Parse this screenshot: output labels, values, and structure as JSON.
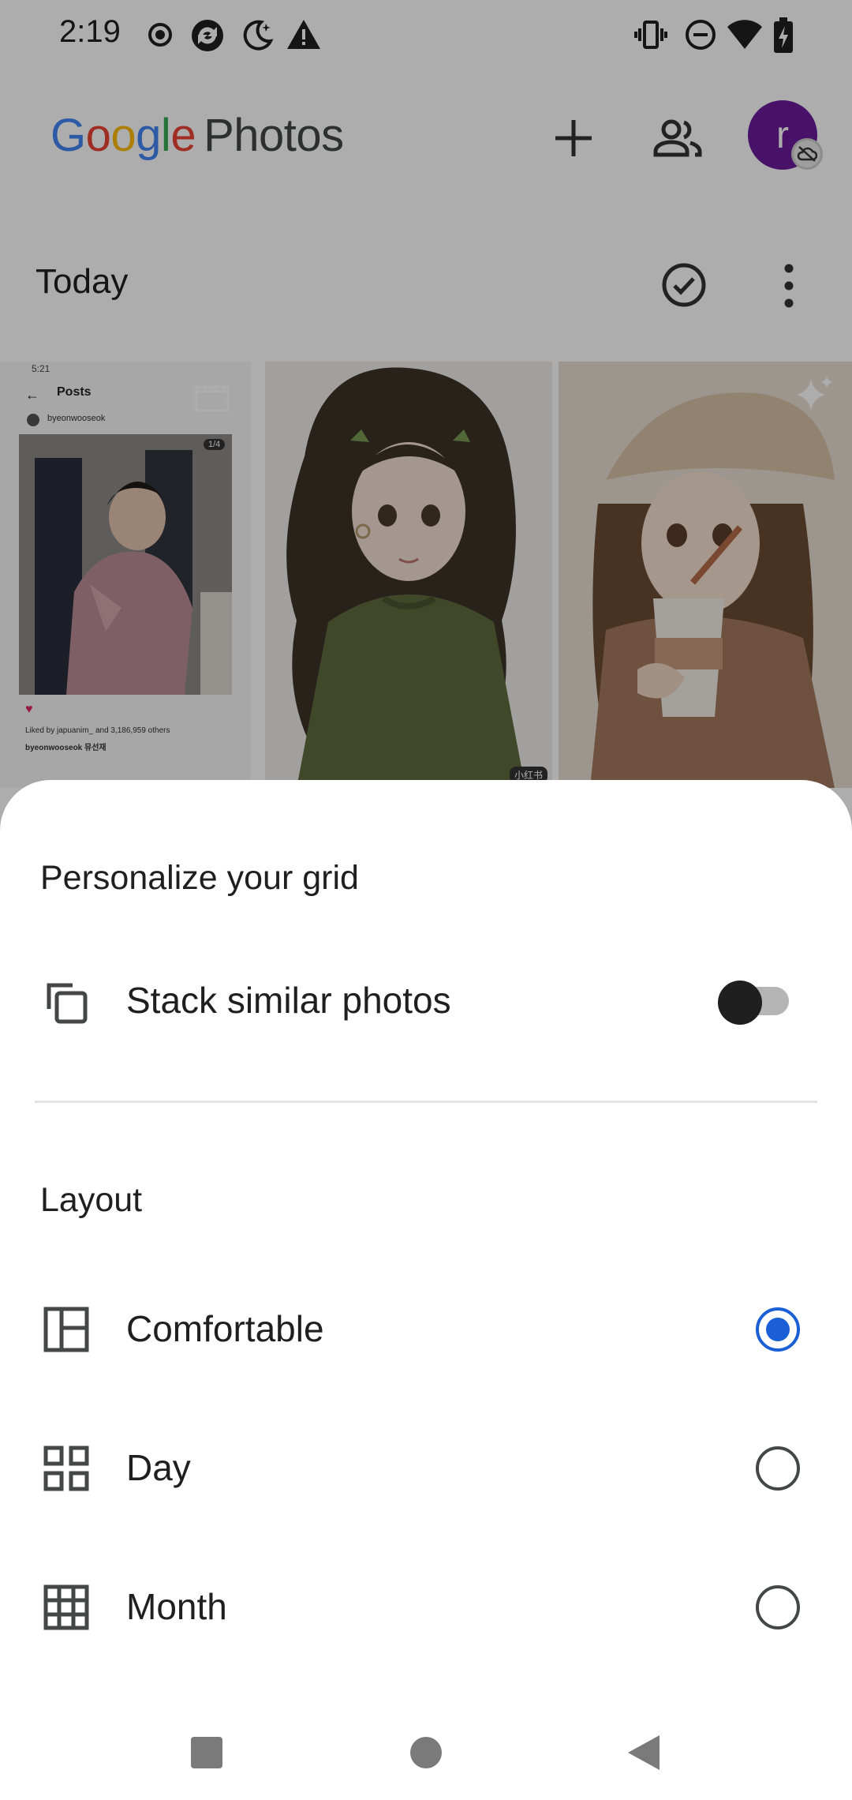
{
  "status_bar": {
    "time": "2:19",
    "left_icons": [
      "record-icon",
      "sync-icon",
      "night-mode-icon",
      "warning-icon"
    ],
    "right_icons": [
      "vibrate-icon",
      "do-not-disturb-icon",
      "wifi-icon",
      "battery-charging-icon"
    ]
  },
  "header": {
    "logo_word": "Google",
    "logo_product": "Photos",
    "avatar_letter": "r",
    "logo_colors": [
      "#4285F4",
      "#EA4335",
      "#FBBC05",
      "#4285F4",
      "#34A853",
      "#EA4335"
    ]
  },
  "section": {
    "title": "Today"
  },
  "grid_tiles": [
    {
      "kind": "screenshot",
      "icon": "video-clapper-icon",
      "text": {
        "time": "5:21",
        "title": "Posts",
        "user": "byeonwooseok",
        "counter": "1/4",
        "likes": "Liked by japuanim_ and 3,186,959 others",
        "caption": "byeonwooseok 뮤선재"
      }
    },
    {
      "kind": "illustration",
      "watermark": "小红书"
    },
    {
      "kind": "illustration",
      "icon": "sparkle-icon"
    }
  ],
  "sheet": {
    "title": "Personalize your grid",
    "stack_label": "Stack similar photos",
    "stack_enabled": false,
    "layout_title": "Layout",
    "options": [
      {
        "label": "Comfortable",
        "selected": true
      },
      {
        "label": "Day",
        "selected": false
      },
      {
        "label": "Month",
        "selected": false
      }
    ]
  },
  "nav_bar": {
    "buttons": [
      "recents-button",
      "home-button",
      "back-button"
    ]
  },
  "colors": {
    "accent": "#1a5fd6",
    "avatar": "#6a1b9a",
    "text": "#1f1f1f"
  }
}
